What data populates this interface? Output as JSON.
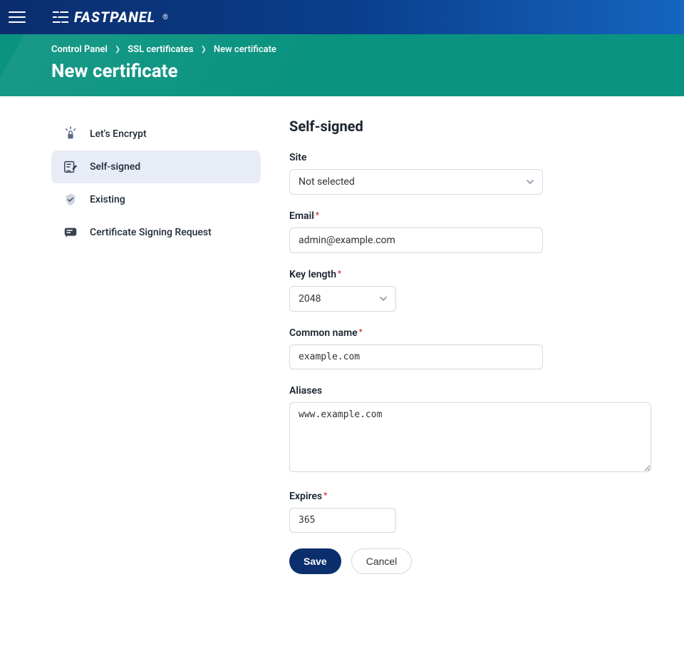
{
  "brand": {
    "name": "FASTPANEL",
    "trademark": "®"
  },
  "breadcrumb": {
    "items": [
      {
        "label": "Control Panel"
      },
      {
        "label": "SSL certificates"
      },
      {
        "label": "New certificate"
      }
    ]
  },
  "page": {
    "title": "New certificate"
  },
  "sidenav": {
    "items": [
      {
        "label": "Let's Encrypt",
        "icon": "lock-rays-icon"
      },
      {
        "label": "Self-signed",
        "icon": "note-pencil-icon",
        "active": true
      },
      {
        "label": "Existing",
        "icon": "shield-check-icon"
      },
      {
        "label": "Certificate Signing Request",
        "icon": "message-lines-icon"
      }
    ]
  },
  "form": {
    "title": "Self-signed",
    "fields": {
      "site": {
        "label": "Site",
        "value": "Not selected"
      },
      "email": {
        "label": "Email",
        "required": true,
        "value": "admin@example.com"
      },
      "key_length": {
        "label": "Key length",
        "required": true,
        "value": "2048"
      },
      "common_name": {
        "label": "Common name",
        "required": true,
        "value": "example.com"
      },
      "aliases": {
        "label": "Aliases",
        "value": "www.example.com"
      },
      "expires": {
        "label": "Expires",
        "required": true,
        "value": "365"
      }
    },
    "actions": {
      "save": "Save",
      "cancel": "Cancel"
    }
  }
}
